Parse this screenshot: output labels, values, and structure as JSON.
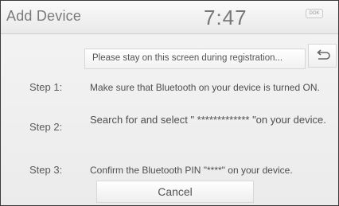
{
  "header": {
    "title": "Add Device",
    "clock": "7:47",
    "badge": "DOK"
  },
  "info_message": "Please stay on this screen during registration...",
  "back_icon": "return-arrow-icon",
  "steps": [
    {
      "label": "Step 1:",
      "text": "Make sure that Bluetooth on your device is turned ON."
    },
    {
      "label": "Step 2:",
      "text": "Search for and select \" ************* \"on your device."
    },
    {
      "label": "Step 3:",
      "text": "Confirm the Bluetooth PIN \"****\" on your device."
    }
  ],
  "cancel_label": "Cancel"
}
